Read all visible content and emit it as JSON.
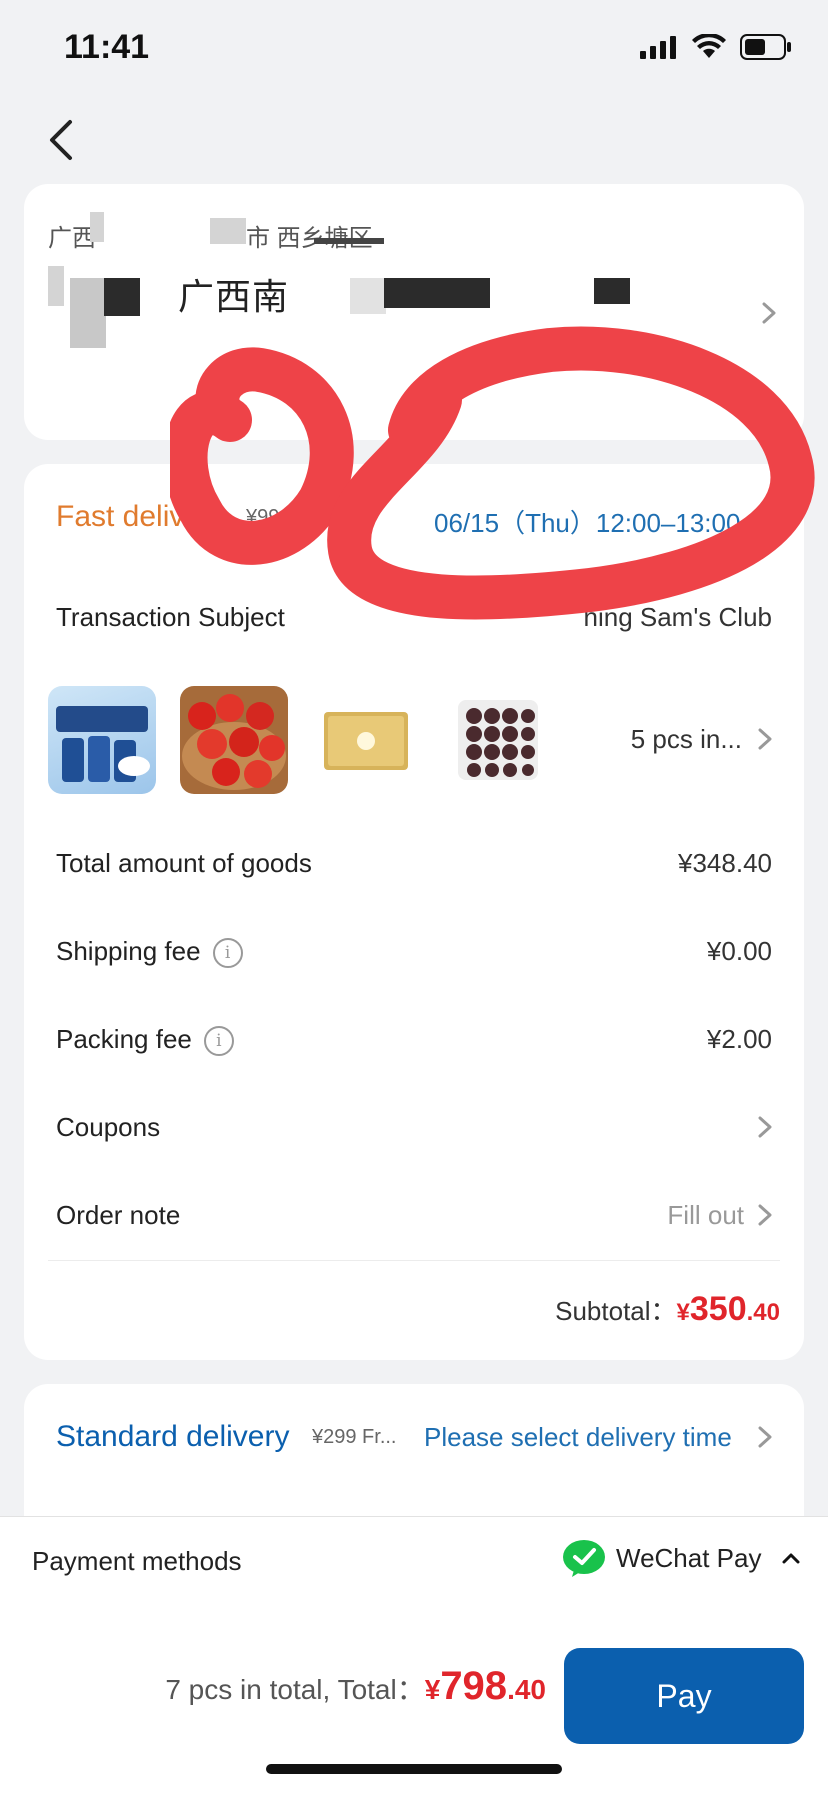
{
  "status_bar": {
    "time": "11:41"
  },
  "address": {
    "line1": "广西",
    "line1_suffix": "市 西乡塘区",
    "line2": "广西南"
  },
  "fast_delivery": {
    "title": "Fast delivery",
    "note": "¥99 free ship",
    "time": "06/15（Thu）12:00–13:00",
    "subject_label": "Transaction Subject",
    "subject_value": "ning Sam's Club",
    "items_summary": "5 pcs in...",
    "rows": [
      {
        "label": "Total amount of goods",
        "value": "¥348.40"
      },
      {
        "label": "Shipping fee",
        "value": "¥0.00"
      },
      {
        "label": "Packing fee",
        "value": "¥2.00"
      },
      {
        "label": "Coupons",
        "value": ""
      },
      {
        "label": "Order note",
        "value": "Fill out"
      }
    ],
    "subtotal_label": "Subtotal：",
    "subtotal_currency": "¥",
    "subtotal_int": "350",
    "subtotal_dec": ".40"
  },
  "standard_delivery": {
    "title": "Standard delivery",
    "note": "¥299 Fr...",
    "action": "Please select delivery time"
  },
  "payment": {
    "label": "Payment methods",
    "method": "WeChat Pay",
    "summary": "7 pcs in total, Total：",
    "total_currency": "¥",
    "total_int": "798",
    "total_dec": ".40",
    "pay_label": "Pay"
  },
  "colors": {
    "accent_blue": "#0b5fae",
    "fast_orange": "#e07b2e",
    "price_red": "#e0252b",
    "annotation_red": "#ee4348",
    "wechat_green": "#19c24b"
  }
}
